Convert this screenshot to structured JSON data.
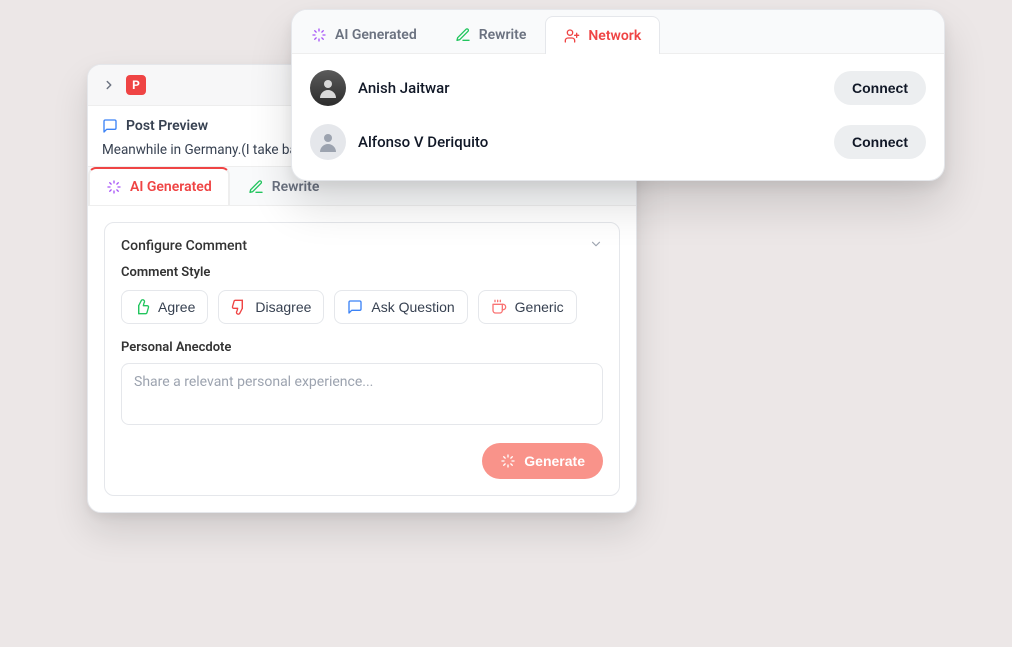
{
  "logo_letter": "P",
  "post_preview": {
    "title": "Post Preview",
    "text": "Meanwhile in Germany.(I take back a"
  },
  "back_tabs": {
    "ai": "AI Generated",
    "rewrite": "Rewrite"
  },
  "config": {
    "title": "Configure Comment",
    "style_label": "Comment Style",
    "pills": {
      "agree": "Agree",
      "disagree": "Disagree",
      "ask": "Ask Question",
      "generic": "Generic"
    },
    "anecdote_label": "Personal Anecdote",
    "anecdote_placeholder": "Share a relevant personal experience...",
    "generate": "Generate"
  },
  "front_tabs": {
    "ai": "AI Generated",
    "rewrite": "Rewrite",
    "network": "Network"
  },
  "network": {
    "people": [
      {
        "name": "Anish Jaitwar"
      },
      {
        "name": "Alfonso V Deriquito"
      }
    ],
    "connect_label": "Connect"
  }
}
